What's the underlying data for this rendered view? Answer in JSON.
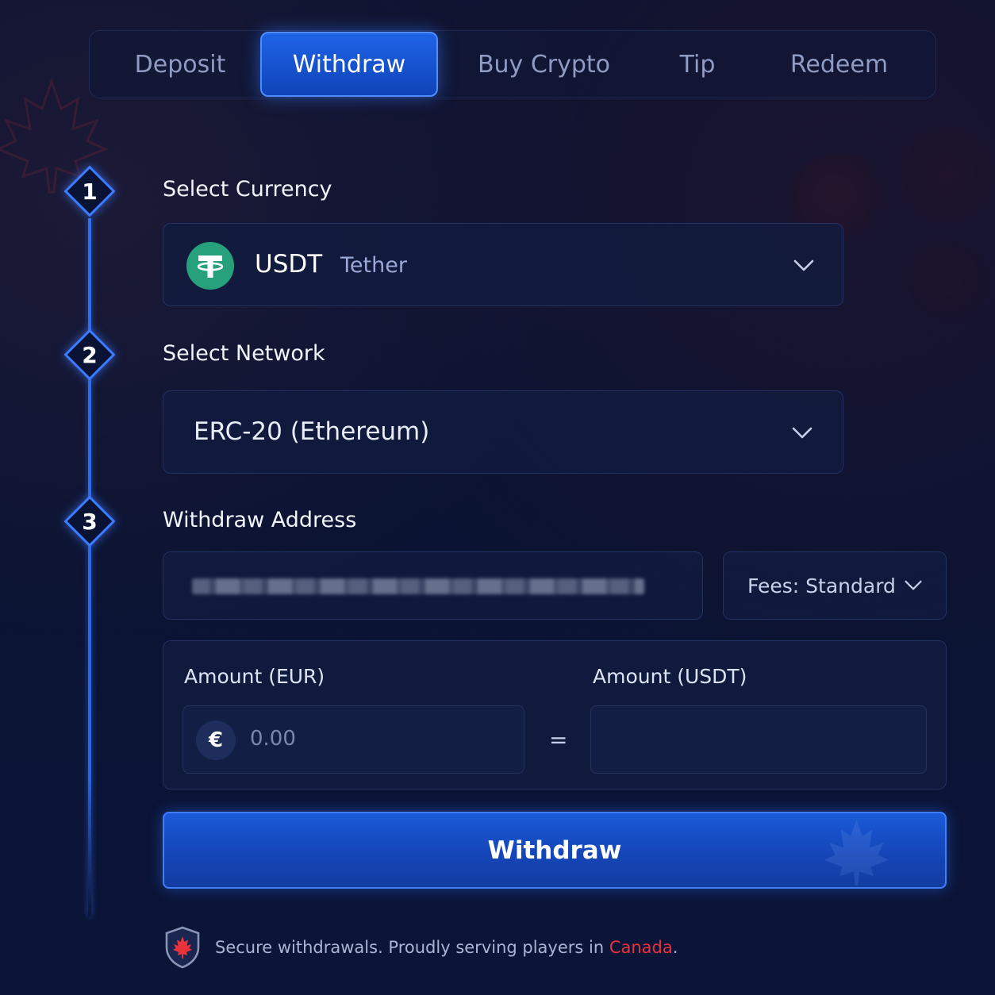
{
  "tabs": [
    {
      "label": "Deposit",
      "active": false
    },
    {
      "label": "Withdraw",
      "active": true
    },
    {
      "label": "Buy Crypto",
      "active": false
    },
    {
      "label": "Tip",
      "active": false
    },
    {
      "label": "Redeem",
      "active": false
    }
  ],
  "steps": [
    {
      "number": "1",
      "label": "Select Currency"
    },
    {
      "number": "2",
      "label": "Select Network"
    },
    {
      "number": "3",
      "label": "Withdraw Address"
    }
  ],
  "currency": {
    "code": "USDT",
    "name": "Tether",
    "icon": "tether-icon",
    "icon_color": "#26a17b"
  },
  "network": {
    "selected": "ERC-20 (Ethereum)"
  },
  "address": {
    "value_hidden": true
  },
  "fees": {
    "label": "Fees: Standard"
  },
  "amount": {
    "fiat_label": "Amount (EUR)",
    "fiat_symbol": "€",
    "fiat_value": "0.00",
    "equals": "=",
    "crypto_label": "Amount (USDT)",
    "crypto_value": ""
  },
  "submit": {
    "label": "Withdraw"
  },
  "footer": {
    "text_before": "Secure withdrawals. Proudly serving players in ",
    "highlight": "Canada",
    "text_after": "."
  },
  "colors": {
    "accent": "#1e63e6",
    "highlight_red": "#e8323c",
    "background": "#0b1230"
  }
}
